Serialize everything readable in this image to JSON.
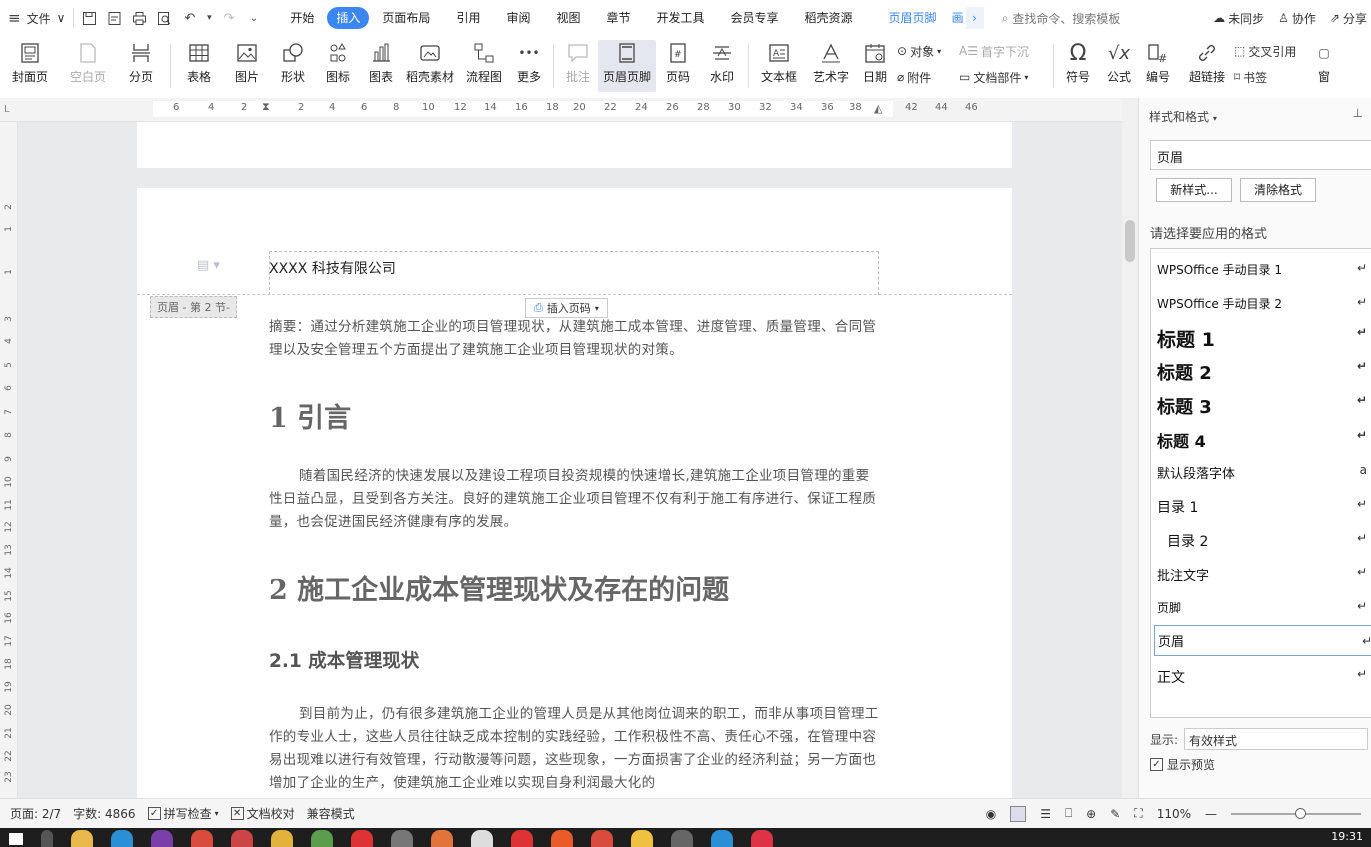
{
  "menubar": {
    "file_label": "文件",
    "tabs": [
      "开始",
      "插入",
      "页面布局",
      "引用",
      "审阅",
      "视图",
      "章节",
      "开发工具",
      "会员专享",
      "稻壳资源"
    ],
    "active_tab": "插入",
    "context_tab": "页眉页脚",
    "context_tab_truncated": "画",
    "search_label": "查找命令、搜索模板",
    "sync_label": "未同步",
    "collab_label": "协作",
    "share_label": "分享"
  },
  "ribbon": {
    "cover_page": "封面页",
    "blank_page": "空白页",
    "page_break": "分页",
    "table": "表格",
    "picture": "图片",
    "shape": "形状",
    "icon_lib": "图标",
    "chart": "图表",
    "shell_material": "稻壳素材",
    "flowchart": "流程图",
    "more": "更多",
    "comment": "批注",
    "header_footer": "页眉页脚",
    "page_number": "页码",
    "watermark": "水印",
    "textbox": "文本框",
    "wordart": "艺术字",
    "date": "日期",
    "object": "对象",
    "attachment": "附件",
    "dropcap": "首字下沉",
    "doc_parts": "文档部件",
    "symbol": "符号",
    "formula": "公式",
    "numbering": "编号",
    "hyperlink": "超链接",
    "crossref": "交叉引用",
    "bookmark": "书签",
    "window": "窗"
  },
  "ruler": {
    "h_ticks": [
      "6",
      "4",
      "2",
      "2",
      "4",
      "6",
      "8",
      "10",
      "12",
      "14",
      "16",
      "18",
      "20",
      "22",
      "24",
      "26",
      "28",
      "30",
      "32",
      "34",
      "36",
      "38",
      "42",
      "44",
      "46"
    ],
    "v_ticks": [
      "2",
      "1",
      "1",
      "3",
      "4",
      "5",
      "6",
      "7",
      "8",
      "9",
      "10",
      "11",
      "12",
      "13",
      "14",
      "15",
      "16",
      "17",
      "18",
      "19",
      "20",
      "21",
      "22",
      "23"
    ]
  },
  "document": {
    "header_text": "XXXX 科技有限公司",
    "header_tag": "页眉 - 第 2 节-",
    "insert_page_number": "插入页码",
    "abstract": "摘要：通过分析建筑施工企业的项目管理现状，从建筑施工成本管理、进度管理、质量管理、合同管理以及安全管理五个方面提出了建筑施工企业项目管理现状的对策。",
    "h1_intro": "1 引言",
    "intro_para": "随着国民经济的快速发展以及建设工程项目投资规模的快速增长,建筑施工企业项目管理的重要性日益凸显，且受到各方关注。良好的建筑施工企业项目管理不仅有利于施工有序进行、保证工程质量，也会促进国民经济健康有序的发展。",
    "h1_sec2": "2 施工企业成本管理现状及存在的问题",
    "h2_sec21": "2.1 成本管理现状",
    "sec21_para": "到目前为止，仍有很多建筑施工企业的管理人员是从其他岗位调来的职工，而非从事项目管理工作的专业人士，这些人员往往缺乏成本控制的实践经验，工作积极性不高、责任心不强，在管理中容易出现难以进行有效管理，行动散漫等问题，这些现象，一方面损害了企业的经济利益；另一方面也增加了企业的生产，使建筑施工企业难以实现自身利润最大化的"
  },
  "styles_panel": {
    "title": "样式和格式",
    "current_style": "页眉",
    "new_style": "新样式...",
    "clear_format": "清除格式",
    "hint": "请选择要应用的格式",
    "items": [
      "WPSOffice 手动目录 1",
      "WPSOffice 手动目录 2",
      "标题 1",
      "标题 2",
      "标题 3",
      "标题 4",
      "默认段落字体",
      "目录 1",
      "目录 2",
      "批注文字",
      "页脚",
      "页眉",
      "正文"
    ],
    "selected": "页眉",
    "show_label": "显示:",
    "show_value": "有效样式",
    "preview_label": "显示预览"
  },
  "status": {
    "page": "页面: 2/7",
    "words": "字数: 4866",
    "spellcheck": "拼写检查",
    "doc_check": "文档校对",
    "compat": "兼容模式",
    "zoom": "110%"
  },
  "taskbar": {
    "clock": "19:31"
  },
  "colors": {
    "accent": "#3b86f0",
    "taskbar": "#1e1e1e"
  }
}
